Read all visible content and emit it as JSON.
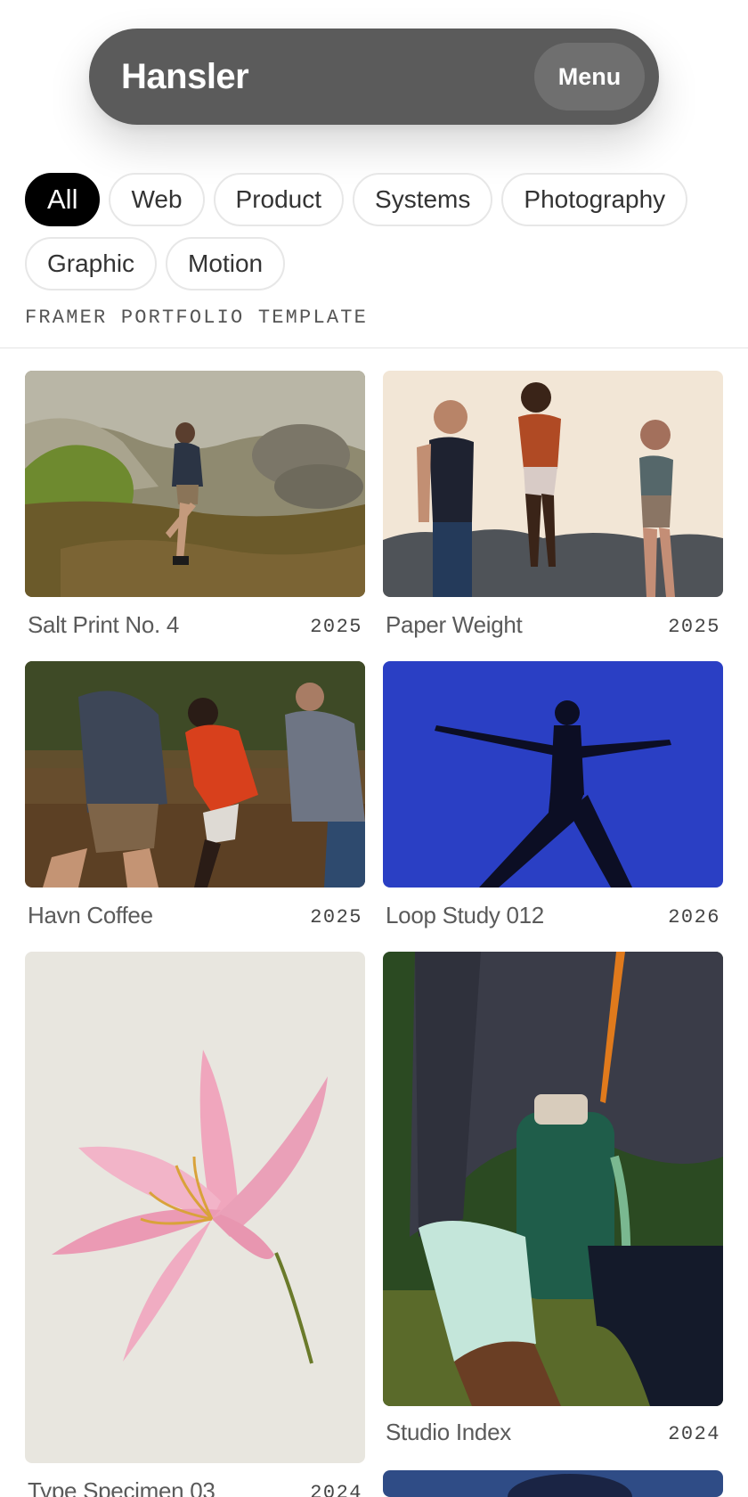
{
  "header": {
    "brand": "Hansler",
    "menu_label": "Menu"
  },
  "filters": [
    "All",
    "Web",
    "Product",
    "Systems",
    "Photography",
    "Graphic",
    "Motion"
  ],
  "active_filter": "All",
  "tagline": "FRAMER PORTFOLIO TEMPLATE",
  "projects": [
    {
      "title": "Salt Print No. 4",
      "year": "2025",
      "image": "hiker-on-rocky-hillside"
    },
    {
      "title": "Paper Weight",
      "year": "2025",
      "image": "three-runners-on-cliff"
    },
    {
      "title": "Havn Coffee",
      "year": "2025",
      "image": "runners-motion-blur"
    },
    {
      "title": "Loop Study 012",
      "year": "2026",
      "image": "yoga-pose-blue-background"
    },
    {
      "title": "Type Specimen 03",
      "year": "2024",
      "image": "pink-lily-flower"
    },
    {
      "title": "Studio Index",
      "year": "2024",
      "image": "runner-with-water-bottle"
    },
    {
      "title": "",
      "year": "",
      "image": "partial-blue-image"
    }
  ]
}
